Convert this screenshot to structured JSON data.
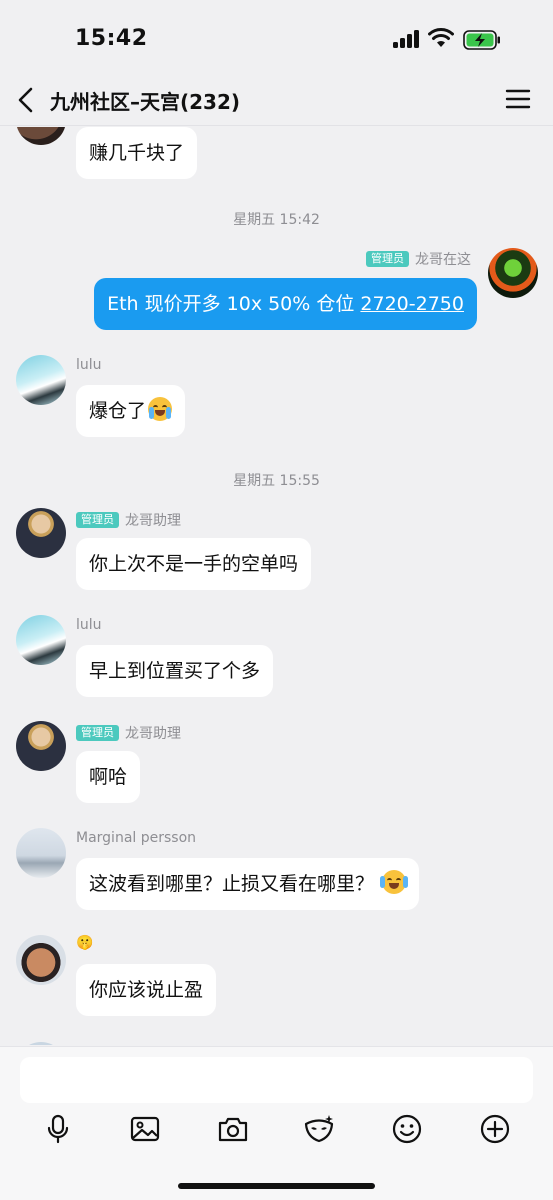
{
  "status_bar": {
    "time": "15:42"
  },
  "header": {
    "title": "九州社区–天宫(232)"
  },
  "messages": [
    {
      "text": "赚几千块了"
    },
    {
      "timestamp": "星期五 15:42"
    },
    {
      "badge": "管理员",
      "sender": "龙哥在这",
      "text_prefix": "Eth 现价开多 10x 50% 仓位 ",
      "text_link": "2720-2750"
    },
    {
      "sender": "lulu",
      "text": "爆仓了"
    },
    {
      "timestamp": "星期五 15:55"
    },
    {
      "badge": "管理员",
      "sender": "龙哥助理",
      "text": "你上次不是一手的空单吗"
    },
    {
      "sender": "lulu",
      "text": "早上到位置买了个多"
    },
    {
      "badge": "管理员",
      "sender": "龙哥助理",
      "text": "啊哈"
    },
    {
      "sender": "Marginal persson",
      "text": "这波看到哪里？止损又看在哪里？"
    },
    {
      "sender": "🤫",
      "text": "你应该说止盈"
    }
  ],
  "input": {
    "placeholder": ""
  },
  "toolbar_icons": [
    "microphone-icon",
    "image-icon",
    "camera-icon",
    "mask-icon",
    "smiley-icon",
    "plus-icon"
  ],
  "colors": {
    "my_bubble": "#1a9bf0",
    "admin_badge": "#4cc9be",
    "background": "#f0f0f2"
  }
}
